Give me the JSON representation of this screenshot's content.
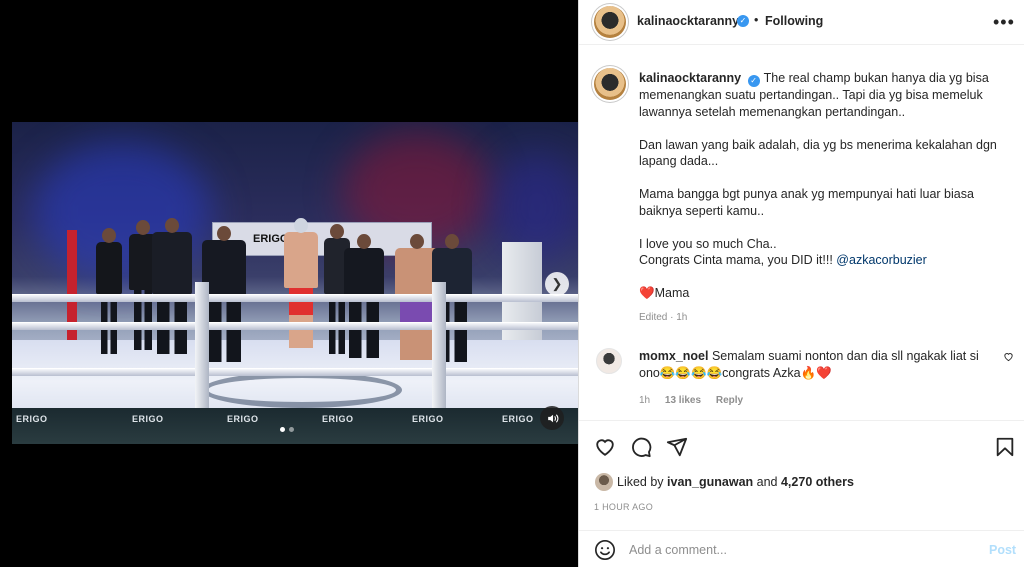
{
  "media": {
    "banner_text": "ERIGO",
    "apron_labels": [
      "ERIGO",
      "ERIGO",
      "ERIGO",
      "ERIGO",
      "ERIGO",
      "ERIGO"
    ],
    "carousel_dots": 2,
    "active_dot": 0
  },
  "header": {
    "username": "kalinaocktaranny",
    "separator": "•",
    "follow_status": "Following",
    "more_label": "•••"
  },
  "caption": {
    "username": "kalinaocktaranny",
    "text_1": "The real champ bukan hanya dia yg bisa memenangkan suatu pertandingan.. Tapi dia yg bisa memeluk lawannya setelah memenangkan pertandingan..\n\nDan lawan yang baik adalah, dia yg bs menerima kekalahan dgn lapang dada...\n\nMama bangga bgt punya anak yg mempunyai hati luar biasa baiknya seperti kamu..\n\nI love you so much Cha..\nCongrats Cinta mama, you DID it!!! ",
    "mention": "@azkacorbuzier",
    "sign_heart": "❤️",
    "sign_name": "Mama",
    "edited": "Edited · 1h"
  },
  "comment": {
    "username": "momx_noel",
    "text": "Semalam suami nonton dan dia sll ngakak liat si ono😂😂😂😂congrats Azka🔥❤️",
    "time": "1h",
    "likes": "13 likes",
    "reply": "Reply"
  },
  "likes": {
    "prefix": "Liked by ",
    "liker": "ivan_gunawan",
    "middle": " and ",
    "others": "4,270 others"
  },
  "timestamp": "1 HOUR AGO",
  "add_comment": {
    "placeholder": "Add a comment...",
    "post_label": "Post"
  },
  "colors": {
    "accent": "#3897f0",
    "link": "#00376b",
    "heart": "#ed4956",
    "post_disabled": "#b2dffc"
  }
}
